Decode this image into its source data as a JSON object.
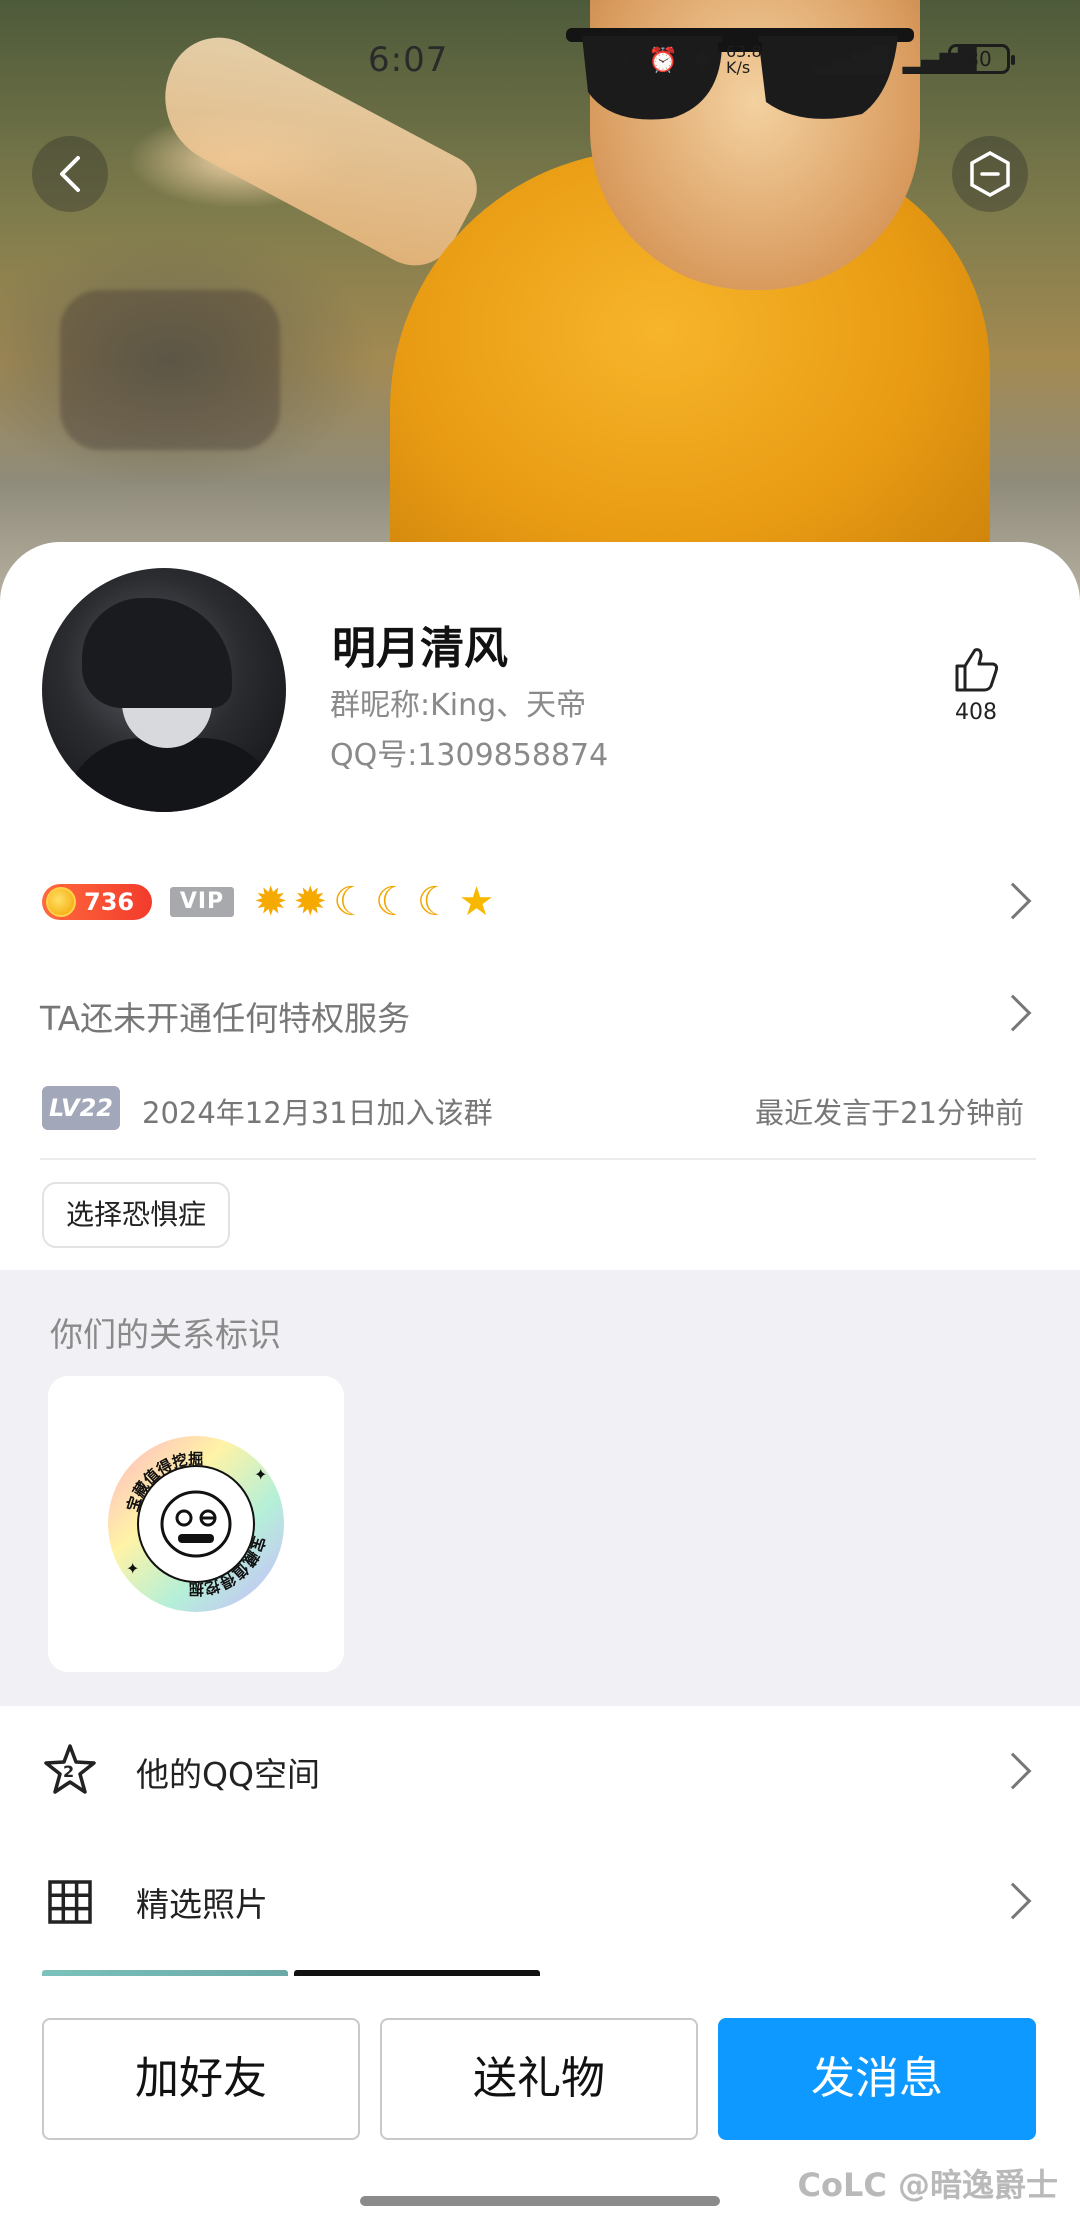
{
  "status_bar": {
    "time": "6:07",
    "network_speed": "63.8 K/s",
    "battery": "80"
  },
  "profile": {
    "nickname": "明月清风",
    "group_nickname": "群昵称:King、天帝",
    "qq_number": "QQ号:1309858874",
    "like_count": "408"
  },
  "badges": {
    "coin_value": "736",
    "vip_label": "VIP",
    "level_icons": [
      "sun",
      "sun",
      "moon",
      "moon",
      "moon",
      "star"
    ]
  },
  "privilege_text": "TA还未开通任何特权服务",
  "group_info": {
    "level_tag": "LV22",
    "join_date": "2024年12月31日加入该群",
    "last_speak": "最近发言于21分钟前"
  },
  "tags": [
    "选择恐惧症"
  ],
  "relation": {
    "title": "你们的关系标识",
    "badge_text": "宝藏值得挖掘"
  },
  "list": {
    "qzone_label": "他的QQ空间",
    "photos_label": "精选照片"
  },
  "actions": {
    "add_friend": "加好友",
    "send_gift": "送礼物",
    "send_message": "发消息"
  },
  "watermark": "CoLC @暗逸爵士",
  "colors": {
    "primary": "#0d99ff",
    "coin_badge": "#f23b2c",
    "vip_badge": "#a7a9ad",
    "level_tag": "#a2a7b9",
    "section_bg": "#f1f1f5"
  }
}
